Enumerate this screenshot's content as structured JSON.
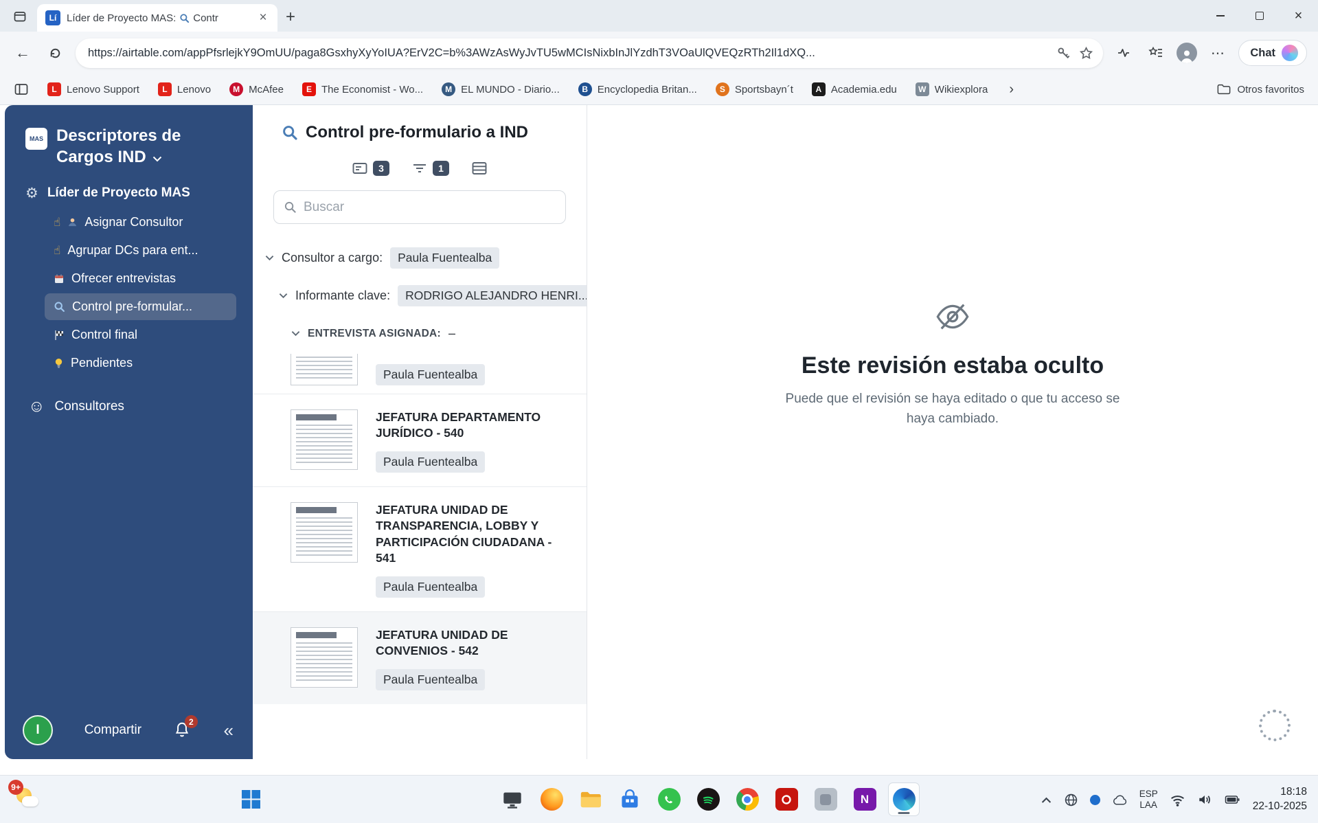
{
  "browser": {
    "tab": {
      "title_prefix": "Líder de Proyecto MAS:",
      "title_suffix": "Contr",
      "favicon_text": "Lí"
    },
    "url": "https://airtable.com/appPfsrlejkY9OmUU/paga8GsxhyXyYoIUA?ErV2C=b%3AWzAsWyJvTU5wMCIsNixbInJlYzdhT3VOaUlQVEQzRTh2Il1dXQ...",
    "chat_label": "Chat",
    "bookmarks": [
      {
        "label": "Lenovo Support",
        "initial": "L",
        "color": "#e2231a"
      },
      {
        "label": "Lenovo",
        "initial": "L",
        "color": "#e2231a"
      },
      {
        "label": "McAfee",
        "initial": "M",
        "color": "#c8102e"
      },
      {
        "label": "The Economist - Wo...",
        "initial": "E",
        "color": "#e3120b"
      },
      {
        "label": "EL MUNDO - Diario...",
        "initial": "M",
        "color": "#365a82"
      },
      {
        "label": "Encyclopedia Britan...",
        "initial": "B",
        "color": "#1f5090"
      },
      {
        "label": "Sportsbayn´t",
        "initial": "S",
        "color": "#e0731d"
      },
      {
        "label": "Academia.edu",
        "initial": "A",
        "color": "#1c1c1c"
      },
      {
        "label": "Wikiexplora",
        "initial": "W",
        "color": "#7d8a97"
      }
    ],
    "bookmarks_overflow_glyph": "›",
    "other_favorites_label": "Otros favoritos"
  },
  "sidebar": {
    "workspace_title": "Descriptores de Cargos IND",
    "logo_text": "MAS",
    "section_label": "Líder de Proyecto MAS",
    "items": [
      {
        "label": "Asignar Consultor"
      },
      {
        "label": "Agrupar DCs para ent..."
      },
      {
        "label": "Ofrecer entrevistas"
      },
      {
        "label": "Control pre-formular..."
      },
      {
        "label": "Control final"
      },
      {
        "label": "Pendientes"
      }
    ],
    "consultores_label": "Consultores",
    "footer": {
      "avatar_initial": "I",
      "share_label": "Compartir",
      "notification_count": "2",
      "collapse_glyph": "«"
    }
  },
  "list_panel": {
    "title": "Control pre-formulario a IND",
    "toolbar": {
      "cards_badge": "3",
      "filter_badge": "1"
    },
    "search_placeholder": "Buscar",
    "groups": [
      {
        "label": "Consultor a cargo:",
        "value": "Paula Fuentealba"
      },
      {
        "label": "Informante clave:",
        "value": "RODRIGO ALEJANDRO HENRI..."
      },
      {
        "label": "ENTREVISTA ASIGNADA:",
        "value": "–"
      }
    ],
    "cards": [
      {
        "assignee": "Paula Fuentealba"
      },
      {
        "title": "JEFATURA DEPARTAMENTO JURÍDICO - 540",
        "assignee": "Paula Fuentealba"
      },
      {
        "title": "JEFATURA UNIDAD DE TRANSPARENCIA, LOBBY Y PARTICIPACIÓN CIUDADANA - 541",
        "assignee": "Paula Fuentealba"
      },
      {
        "title": "JEFATURA UNIDAD DE CONVENIOS - 542",
        "assignee": "Paula Fuentealba"
      }
    ]
  },
  "detail_panel": {
    "heading": "Este revisión estaba oculto",
    "subtext": "Puede que el revisión se haya editado o que tu acceso se haya cambiado."
  },
  "taskbar": {
    "widgets_badge": "9+",
    "language": {
      "line1": "ESP",
      "line2": "LAA"
    },
    "clock": {
      "time": "18:18",
      "date": "22-10-2025"
    }
  }
}
